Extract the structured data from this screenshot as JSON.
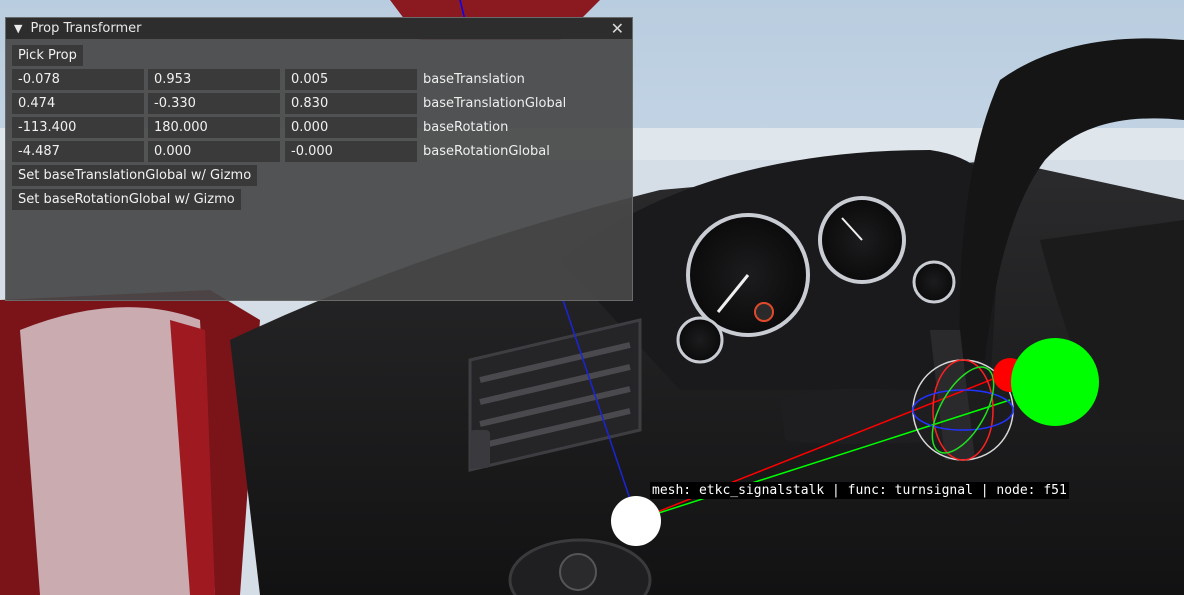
{
  "window": {
    "title": "Prop Transformer",
    "pick_prop": "Pick Prop",
    "rows": [
      {
        "label": "baseTranslation",
        "v": [
          "-0.078",
          "0.953",
          "0.005"
        ]
      },
      {
        "label": "baseTranslationGlobal",
        "v": [
          "0.474",
          "-0.330",
          "0.830"
        ]
      },
      {
        "label": "baseRotation",
        "v": [
          "-113.400",
          "180.000",
          "0.000"
        ]
      },
      {
        "label": "baseRotationGlobal",
        "v": [
          "-4.487",
          "0.000",
          "-0.000"
        ]
      }
    ],
    "set_translation": "Set baseTranslationGlobal w/ Gizmo",
    "set_rotation": "Set baseRotationGlobal w/ Gizmo"
  },
  "overlay": "mesh: etkc_signalstalk | func: turnsignal | node: f51",
  "icons": [
    "collapse-triangle-icon",
    "close-icon"
  ],
  "colors": {
    "gizmo_x": "#ff0000",
    "gizmo_y": "#00ff00",
    "gizmo_z": "#0000ff"
  }
}
